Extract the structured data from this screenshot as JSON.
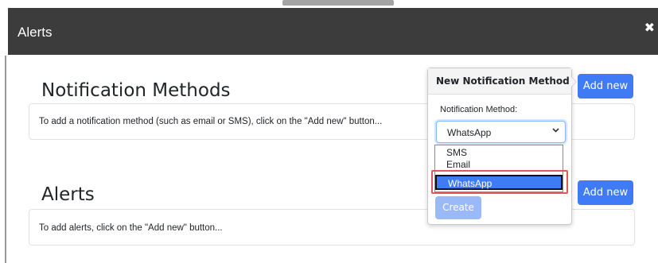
{
  "dialog": {
    "title": "Alerts",
    "close_symbol": "✖"
  },
  "notification_methods": {
    "heading": "Notification Methods",
    "info_text": "To add a notification method (such as email or SMS), click on the \"Add new\" button...",
    "add_button": "Add new"
  },
  "alerts": {
    "heading": "Alerts",
    "info_text": "To add alerts, click on the \"Add new\" button...",
    "add_button": "Add new"
  },
  "popover": {
    "title": "New Notification Method",
    "method_label": "Notification Method:",
    "selected_value": "WhatsApp",
    "options": [
      "SMS",
      "Email",
      "WhatsApp"
    ],
    "highlighted_option": "WhatsApp",
    "create_button": "Create"
  },
  "icons": {
    "close": "close-icon",
    "dropdown": "chevron-down-icon"
  },
  "colors": {
    "header_bg": "#3c3c3c",
    "primary": "#3e7bf4",
    "primary_disabled": "#9ab9f8",
    "highlight_outline": "#e05a5a"
  }
}
